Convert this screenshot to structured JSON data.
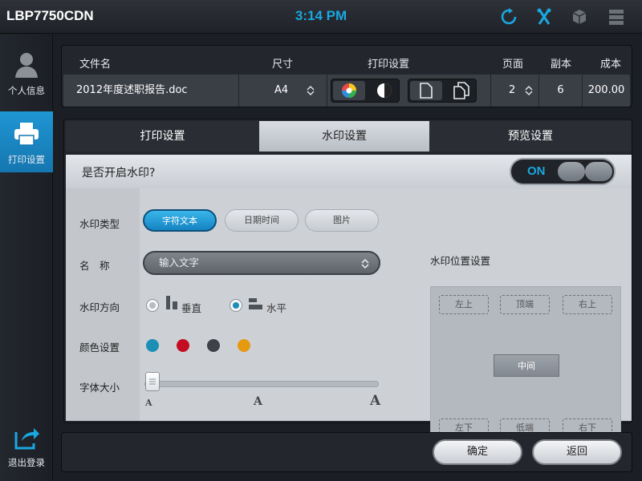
{
  "header": {
    "model": "LBP7750CDN",
    "time": "3:14 PM"
  },
  "top_icons": [
    "refresh-icon",
    "tools-icon",
    "box-icon",
    "menu-icon"
  ],
  "sidebar": {
    "items": [
      {
        "label": "个人信息",
        "icon": "user-icon",
        "active": false
      },
      {
        "label": "打印设置",
        "icon": "printer-icon",
        "active": true
      },
      {
        "label": "退出登录",
        "icon": "logout-icon",
        "active": false
      }
    ]
  },
  "file_table": {
    "headers": {
      "filename": "文件名",
      "size": "尺寸",
      "print_settings": "打印设置",
      "pages": "页面",
      "copies": "副本",
      "cost": "成本"
    },
    "row": {
      "filename": "2012年度述职报告.doc",
      "size": "A4",
      "pages": "2",
      "copies": "6",
      "cost": "200.00"
    }
  },
  "tabs": [
    {
      "label": "打印设置",
      "active": false
    },
    {
      "label": "水印设置",
      "active": true
    },
    {
      "label": "预览设置",
      "active": false
    }
  ],
  "watermark": {
    "question": "是否开启水印?",
    "toggle_label": "ON",
    "type_label": "水印类型",
    "types": [
      {
        "label": "字符文本",
        "selected": true
      },
      {
        "label": "日期时间",
        "selected": false
      },
      {
        "label": "图片",
        "selected": false
      }
    ],
    "name_label": "名　称",
    "name_placeholder": "输入文字",
    "direction_label": "水印方向",
    "directions": [
      {
        "label": "垂直",
        "selected": false
      },
      {
        "label": "水平",
        "selected": true
      }
    ],
    "color_label": "颜色设置",
    "colors": [
      "#1b8fb6",
      "#c30d23",
      "#3e4248",
      "#e59a12"
    ],
    "font_size_label": "字体大小",
    "font_size_level": 0,
    "size_marks": [
      "A",
      "A",
      "A"
    ],
    "position_title": "水印位置设置",
    "positions": {
      "top_left": "左上",
      "top_center": "顶端",
      "top_right": "右上",
      "center": "中间",
      "bottom_left": "左下",
      "bottom_center": "低端",
      "bottom_right": "右下"
    }
  },
  "footer": {
    "confirm": "确定",
    "back": "返回"
  }
}
